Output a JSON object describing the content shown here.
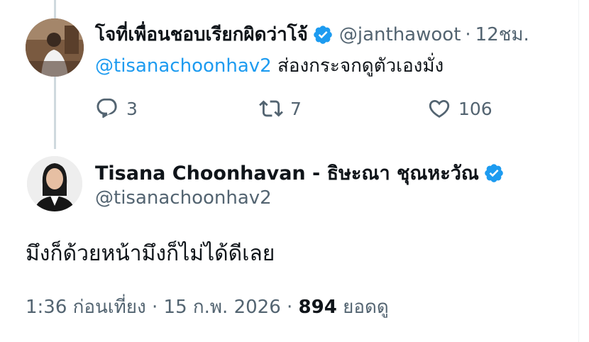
{
  "reply": {
    "author_name": "โจที่เพื่อนชอบเรียกผิดว่าโจ้",
    "handle": "@janthawoot",
    "separator": "·",
    "time": "12ชม.",
    "mention": "@tisanachoonhav2",
    "text": " ส่องกระจกดูตัวเองมั่ง",
    "replies": "3",
    "reposts": "7",
    "likes": "106"
  },
  "main": {
    "author_name": "Tisana Choonhavan - ธิษะณา ชุณหะวัณ",
    "handle": "@tisanachoonhav2",
    "text": "มึงก็ด้วยหน้ามึงก็ไม่ได้ดีเลย",
    "time": "1:36 ก่อนเที่ยง",
    "sep1": "·",
    "date": "15 ก.พ. 2026",
    "sep2": "·",
    "views": "894",
    "views_label": "ยอดดู"
  },
  "colors": {
    "accent": "#1d9bf0",
    "secondary_text": "#536471",
    "thread_line": "#cfd9de"
  },
  "icons": [
    "verified-badge-icon",
    "reply-icon",
    "repost-icon",
    "like-icon"
  ]
}
